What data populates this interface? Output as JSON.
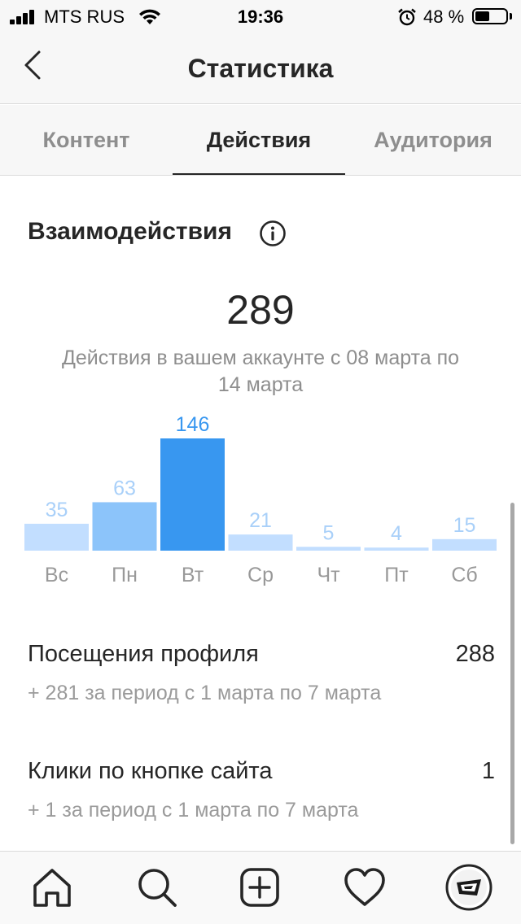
{
  "status_bar": {
    "carrier": "MTS RUS",
    "time": "19:36",
    "battery_percent": "48 %",
    "battery_level": 0.48,
    "icons": [
      "signal-icon",
      "wifi-icon",
      "alarm-icon",
      "battery-icon"
    ]
  },
  "header": {
    "title": "Статистика",
    "back_icon": "chevron-left-icon"
  },
  "tabs": [
    {
      "label": "Контент",
      "active": false
    },
    {
      "label": "Действия",
      "active": true
    },
    {
      "label": "Аудитория",
      "active": false
    }
  ],
  "interactions": {
    "title": "Взаимодействия",
    "info_icon": "info-icon",
    "total": "289",
    "subtitle_line1": "Действия в вашем аккаунте с 08 марта по",
    "subtitle_line2": "14 марта"
  },
  "chart_data": {
    "type": "bar",
    "categories": [
      "Вс",
      "Пн",
      "Вт",
      "Ср",
      "Чт",
      "Пт",
      "Сб"
    ],
    "values": [
      35,
      63,
      146,
      21,
      5,
      4,
      15
    ],
    "highlight_index": 2,
    "colors": {
      "highlight_bar": "#3897f0",
      "bar_near": "#8cc4fa",
      "bar": "#c2deff",
      "highlight_label": "#3897f0",
      "label": "#a9d0f9",
      "axis_label": "#999999"
    }
  },
  "metrics": [
    {
      "label": "Посещения профиля",
      "value": "288",
      "sub": "+ 281 за период с 1 марта по 7 марта"
    },
    {
      "label": "Клики по кнопке сайта",
      "value": "1",
      "sub": "+ 1 за период с 1 марта по 7 марта"
    }
  ],
  "bottom_nav": {
    "items": [
      "home-icon",
      "search-icon",
      "new-post-icon",
      "activity-heart-icon",
      "profile-avatar"
    ]
  }
}
